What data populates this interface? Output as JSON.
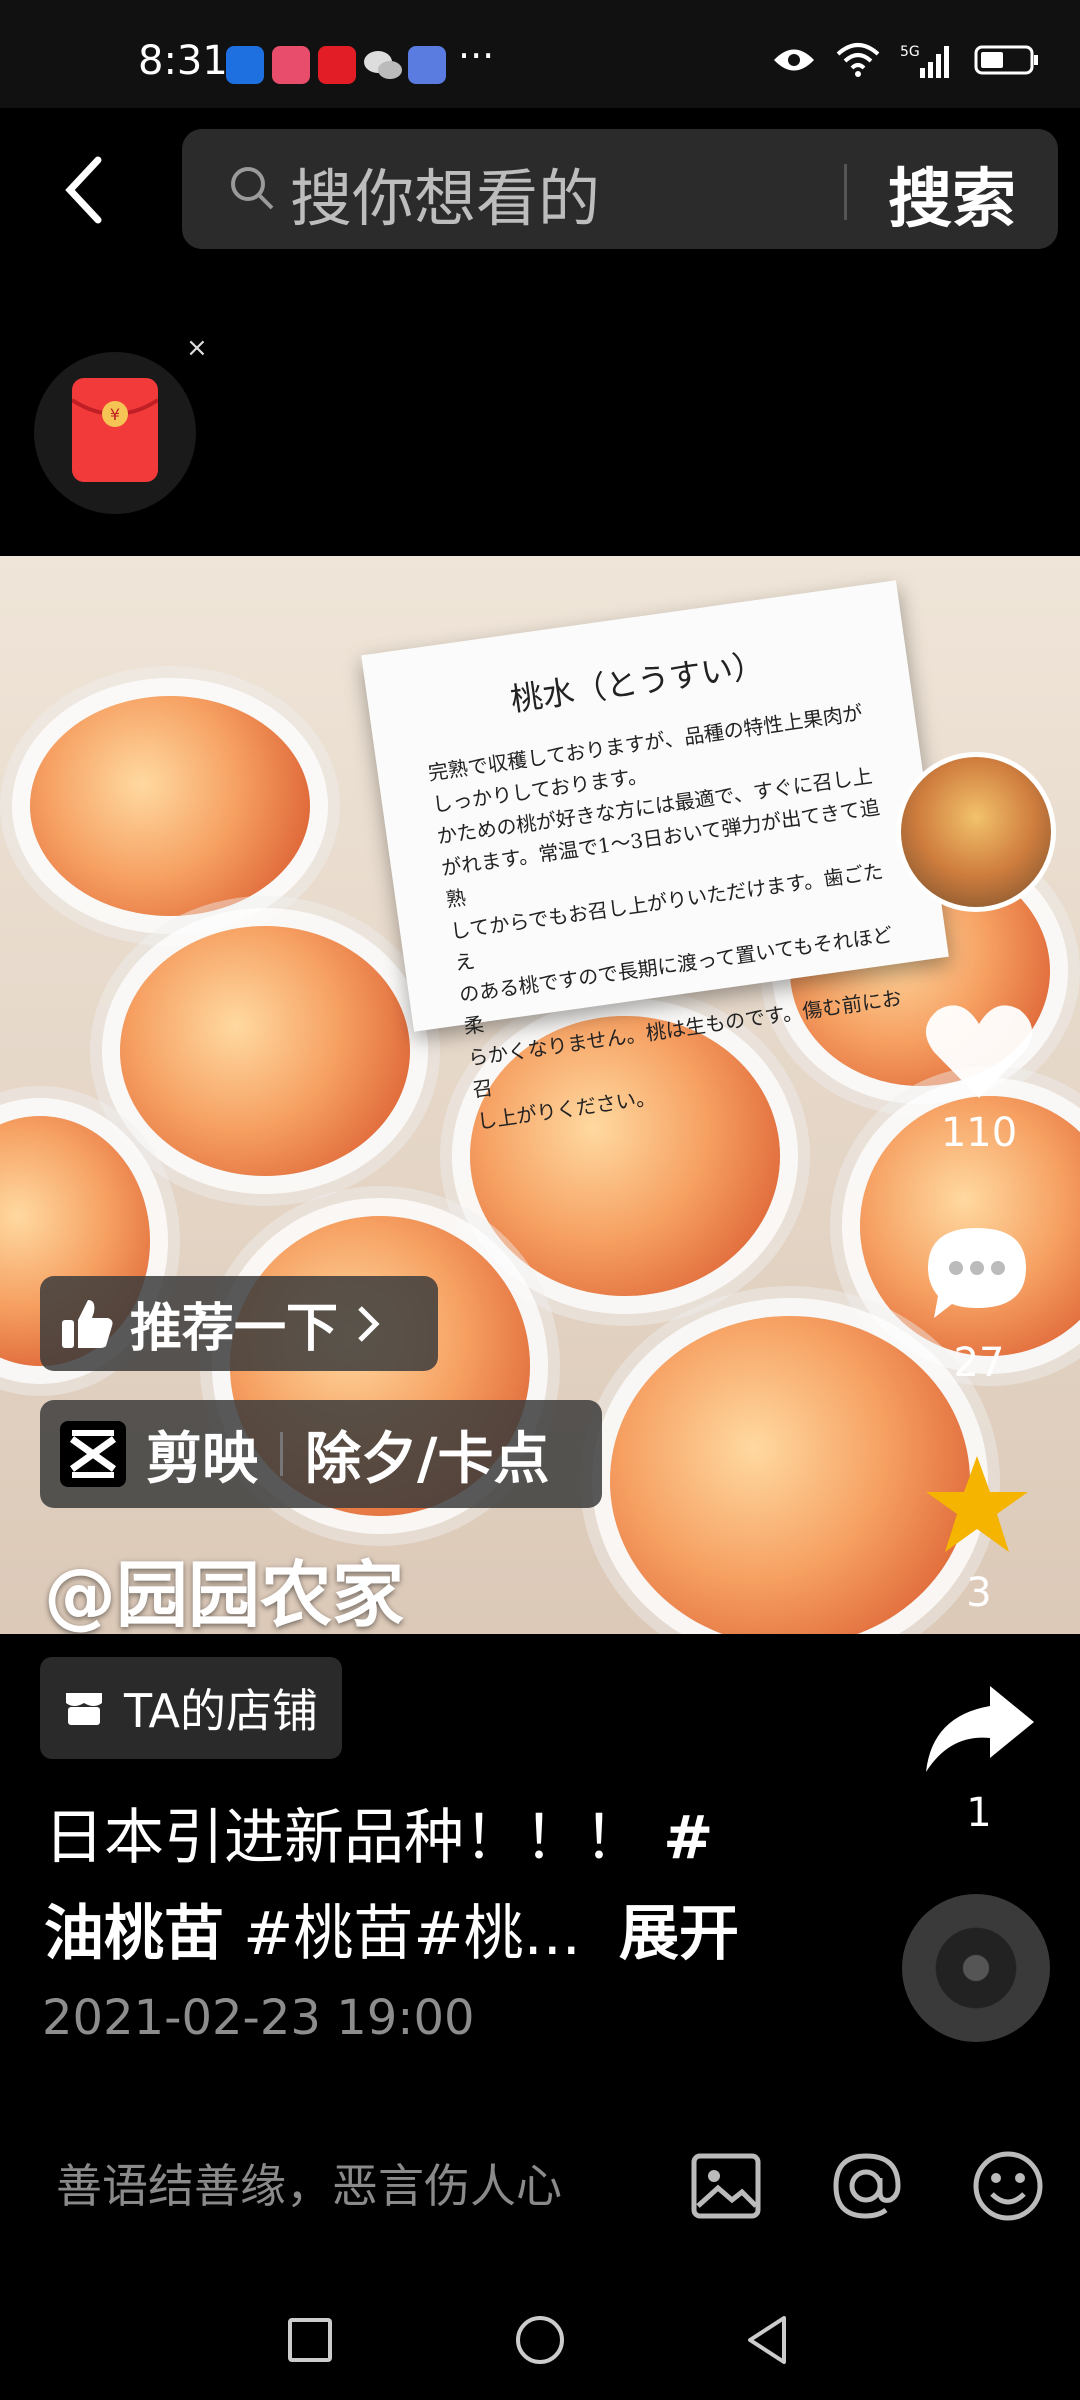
{
  "status_bar": {
    "time": "8:31",
    "app_icons": [
      "app-icon-blue",
      "app-icon-red-book",
      "app-icon-red-heart",
      "wechat-icon",
      "music-icon"
    ],
    "more": "···",
    "indicators": [
      "eye-icon",
      "wifi-icon",
      "5g-signal-icon",
      "battery-icon"
    ]
  },
  "search": {
    "placeholder": "搜你想看的",
    "button_label": "搜索"
  },
  "red_packet": {
    "close": "×",
    "symbol": "¥"
  },
  "video": {
    "card_title": "桃水（とうすい）",
    "card_body": "完熟で収穫しておりますが、品種の特性上果肉が\nしっかりしております。\nかための桃が好きな方には最適で、すぐに召し上\nがれます。常温で1～3日おいて弾力が出てきて追熟\nしてからでもお召し上がりいただけます。歯ごたえ\nのある桃ですので長期に渡って置いてもそれほど柔\nらかくなりません。桃は生ものです。傷む前にお召\nし上がりください。",
    "recommend_label": "推荐一下",
    "capcut_label": "剪映",
    "template_label": "除夕/卡点",
    "author": "@园园农家"
  },
  "actions": {
    "likes": "110",
    "comments": "27",
    "favorites": "3",
    "shares": "1"
  },
  "post": {
    "shop_label": "TA的店铺",
    "desc_part1": "日本引进新品种！！！ ",
    "hash1": "#",
    "hash1b": "油桃苗",
    "desc_part2": " #桃苗#桃...",
    "expand_label": "展开",
    "date": "2021-02-23 19:00"
  },
  "comment_bar": {
    "placeholder": "善语结善缘，恶言伤人心"
  },
  "colors": {
    "background": "#000000",
    "accent_star": "#f5b400",
    "red_packet": "#f23a3a"
  }
}
